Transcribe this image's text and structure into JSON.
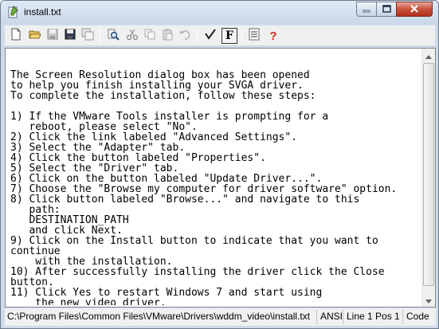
{
  "window": {
    "title": "install.txt",
    "controls": {
      "minimize": "minimize",
      "maximize": "maximize",
      "close": "close"
    }
  },
  "toolbar": {
    "buttons": [
      {
        "name": "new-file",
        "icon": "new-document-icon"
      },
      {
        "name": "open-file",
        "icon": "folder-open-icon"
      },
      {
        "name": "save",
        "icon": "floppy-disk-icon"
      },
      {
        "name": "save-all",
        "icon": "floppy-disks-icon"
      },
      {
        "name": "save-copy",
        "icon": "windows-copy-icon"
      },
      {
        "name": "find",
        "icon": "binoculars-icon"
      },
      {
        "name": "cut",
        "icon": "scissors-icon"
      },
      {
        "name": "copy",
        "icon": "copy-icon"
      },
      {
        "name": "paste",
        "icon": "clipboard-icon"
      },
      {
        "name": "undo",
        "icon": "undo-icon"
      },
      {
        "name": "word-wrap",
        "icon": "checkmark-icon"
      },
      {
        "name": "font",
        "icon": "font-f-icon",
        "label": "F"
      },
      {
        "name": "properties",
        "icon": "list-icon"
      },
      {
        "name": "help",
        "icon": "question-mark-icon",
        "label": "?"
      }
    ]
  },
  "document": {
    "lines": [
      "",
      "The Screen Resolution dialog box has been opened",
      "to help you finish installing your SVGA driver.",
      "To complete the installation, follow these steps:",
      "",
      "1) If the VMware Tools installer is prompting for a",
      "   reboot, please select \"No\".",
      "2) Click the link labeled \"Advanced Settings\".",
      "3) Select the \"Adapter\" tab.",
      "4) Click the button labeled \"Properties\".",
      "5) Select the \"Driver\" tab.",
      "6) Click on the button labeled \"Update Driver...\".",
      "7) Choose the \"Browse my computer for driver software\" option.",
      "8) Click button labeled \"Browse...\" and navigate to this",
      "   path:",
      "   DESTINATION_PATH",
      "   and click Next.",
      "9) Click on the Install button to indicate that you want to",
      "continue",
      "    with the installation.",
      "10) After successfully installing the driver click the Close",
      "button.",
      "11) Click Yes to restart Windows 7 and start using",
      "    the new video driver."
    ]
  },
  "statusbar": {
    "path": "C:\\Program Files\\Common Files\\VMware\\Drivers\\wddm_video\\install.txt",
    "encoding": "ANSI",
    "position": "Line 1 Pos 1",
    "codepage": "Code"
  }
}
